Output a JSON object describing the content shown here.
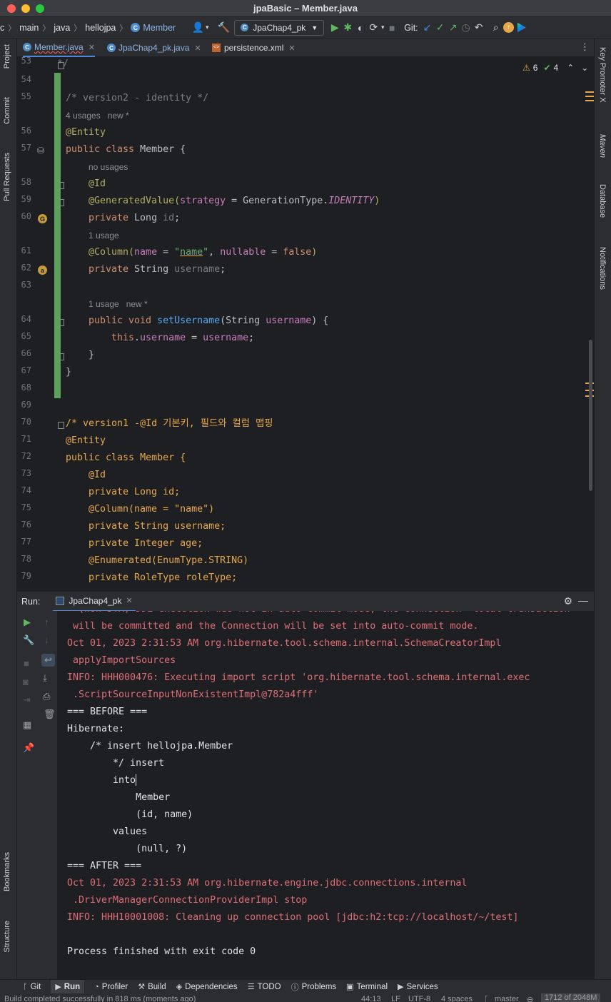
{
  "window": {
    "title": "jpaBasic – Member.java"
  },
  "breadcrumb": {
    "items": [
      "c",
      "main",
      "java",
      "hellojpa",
      "Member"
    ]
  },
  "toolbar": {
    "run_config": "JpaChap4_pk",
    "git_label": "Git:"
  },
  "tabs": [
    {
      "label": "Member.java",
      "active": true
    },
    {
      "label": "JpaChap4_pk.java",
      "active": false
    },
    {
      "label": "persistence.xml",
      "active": false
    }
  ],
  "left_tools": {
    "project": "Project",
    "commit": "Commit",
    "pull_requests": "Pull Requests",
    "bookmarks": "Bookmarks",
    "structure": "Structure"
  },
  "right_tools": {
    "key_promoter": "Key Promoter X",
    "maven": "Maven",
    "database": "Database",
    "notifications": "Notifications"
  },
  "editor": {
    "warnings": "6",
    "weak_warnings": "4",
    "line_numbers": [
      "53",
      "54",
      "55",
      "56",
      "57",
      "58",
      "59",
      "60",
      "61",
      "62",
      "63",
      "64",
      "65",
      "66",
      "67",
      "68",
      "69",
      "70",
      "71",
      "72",
      "73",
      "74",
      "75",
      "76",
      "77",
      "78",
      "79"
    ],
    "hints": {
      "usages_4": "4 usages   new *",
      "no_usages": "no usages",
      "usage_1": "1 usage",
      "usage_1_new": "1 usage   new *"
    },
    "code": {
      "l53": "*/",
      "l55": "/* version2 - identity */",
      "l56": "@Entity",
      "l57_kw": "public class ",
      "l57_name": "Member {",
      "l58": "@Id",
      "l59_a": "@GeneratedValue(",
      "l59_b": "strategy",
      "l59_c": " = GenerationType.",
      "l59_d": "IDENTITY",
      "l59_e": ")",
      "l60_kw": "private ",
      "l60_type": "Long ",
      "l60_f": "id",
      "l60_e": ";",
      "l61_a": "@Column(",
      "l61_b": "name",
      "l61_c": " = ",
      "l61_q1": "\"",
      "l61_d": "name",
      "l61_q2": "\"",
      "l61_e": ", ",
      "l61_f": "nullable",
      "l61_g": " = ",
      "l61_h": "false",
      "l61_i": ")",
      "l62_kw": "private ",
      "l62_type": "String ",
      "l62_f": "username",
      "l62_e": ";",
      "l64_kw": "public void ",
      "l64_fn": "setUsername",
      "l64_p": "(String ",
      "l64_arg": "username",
      "l64_e": ") {",
      "l65_a": "this",
      "l65_b": ".",
      "l65_c": "username",
      "l65_d": " = ",
      "l65_e": "username",
      "l65_f": ";",
      "l66": "}",
      "l67": "}",
      "l70": "/* version1 -@Id 기본키, 필드와 컬럼 맵핑",
      "l71": "@Entity",
      "l72": "public class Member {",
      "l73": "@Id",
      "l74": "private Long id;",
      "l75": "@Column(name = \"name\")",
      "l76": "private String username;",
      "l77": "private Integer age;",
      "l78": "@Enumerated(EnumType.STRING)",
      "l79": "private RoleType roleType;"
    }
  },
  "run": {
    "label": "Run:",
    "tab": "JpaChap4_pk",
    "output": [
      {
        "text": "  (non-JTA) DDL execution was not in auto-commit mode; the Connection 'local transaction'",
        "type": "err"
      },
      {
        "text": " will be committed and the Connection will be set into auto-commit mode.",
        "type": "err"
      },
      {
        "text": "Oct 01, 2023 2:31:53 AM org.hibernate.tool.schema.internal.SchemaCreatorImpl",
        "type": "err"
      },
      {
        "text": " applyImportSources",
        "type": "err"
      },
      {
        "text": "INFO: HHH000476: Executing import script 'org.hibernate.tool.schema.internal.exec",
        "type": "err"
      },
      {
        "text": " .ScriptSourceInputNonExistentImpl@782a4fff'",
        "type": "err"
      },
      {
        "text": "=== BEFORE ===",
        "type": "norm"
      },
      {
        "text": "Hibernate:",
        "type": "norm"
      },
      {
        "text": "    /* insert hellojpa.Member",
        "type": "norm"
      },
      {
        "text": "        */ insert",
        "type": "norm"
      },
      {
        "text": "        into",
        "type": "norm"
      },
      {
        "text": "            Member",
        "type": "norm"
      },
      {
        "text": "            (id, name)",
        "type": "norm"
      },
      {
        "text": "        values",
        "type": "norm"
      },
      {
        "text": "            (null, ?)",
        "type": "norm"
      },
      {
        "text": "=== AFTER ===",
        "type": "norm"
      },
      {
        "text": "Oct 01, 2023 2:31:53 AM org.hibernate.engine.jdbc.connections.internal",
        "type": "err"
      },
      {
        "text": " .DriverManagerConnectionProviderImpl stop",
        "type": "err"
      },
      {
        "text": "INFO: HHH10001008: Cleaning up connection pool [jdbc:h2:tcp://localhost/~/test]",
        "type": "err"
      },
      {
        "text": "",
        "type": "norm"
      },
      {
        "text": "Process finished with exit code 0",
        "type": "norm"
      }
    ]
  },
  "bottom_tools": [
    "Git",
    "Run",
    "Profiler",
    "Build",
    "Dependencies",
    "TODO",
    "Problems",
    "Terminal",
    "Services"
  ],
  "status": {
    "message": "Build completed successfully in 818 ms (moments ago)",
    "position": "44:13",
    "line_sep": "LF",
    "encoding": "UTF-8",
    "indent": "4 spaces",
    "branch": "master",
    "memory": "1712 of 2048M"
  },
  "colors": {
    "accent": "#4e86d9",
    "change": "#5ba05b",
    "error_text": "#e06c75",
    "warning": "#e8a84a"
  }
}
